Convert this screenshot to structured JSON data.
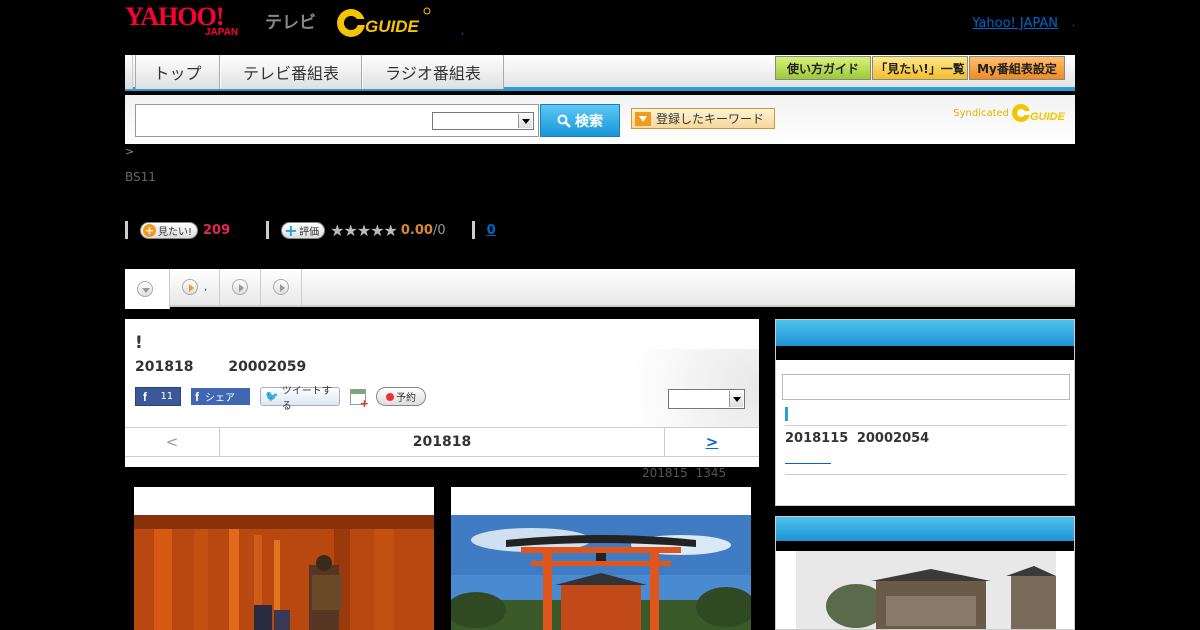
{
  "header": {
    "logo_yahoo": "YAHOO!",
    "logo_japan": "JAPAN",
    "logo_tv": "テレビ",
    "logo_gguide": "G GUIDE",
    "yahoo_link": "Yahoo! JAPAN",
    "yahoo_link_suffix": ".",
    "dot": ","
  },
  "nav": {
    "tabs": [
      "トップ",
      "テレビ番組表",
      "ラジオ番組表"
    ],
    "buttons": [
      "使い方ガイド",
      "「見たい!」一覧",
      "My番組表設定"
    ]
  },
  "search": {
    "button_label": "検索",
    "keyword_button": "登録したキーワード",
    "syndicated": "Syndicated"
  },
  "info": {
    "breadcrumb": ">",
    "channel": "BS11",
    "mitai_label": "見たい!",
    "mitai_count": "209",
    "rate_label": "評価",
    "stars": "★★★★★",
    "score": "0.00",
    "score_count": "/0",
    "link_count": "0"
  },
  "tabbar": {
    "second_label": ","
  },
  "program": {
    "title": "!",
    "date": "201818 20002059",
    "fb_count": "11",
    "fb_share": "シェア",
    "tweet": "ツイートする",
    "reserve": "予約",
    "date_prev": "<",
    "date_current": "201818",
    "date_next": ">",
    "updated": "201815 1345"
  },
  "sidebar": {
    "date": "2018115 20002054"
  },
  "colors": {
    "accent": "#2a9fd6",
    "brand_red": "#ff0033",
    "mitai_pink": "#e8235a",
    "score_orange": "#d6882f"
  }
}
